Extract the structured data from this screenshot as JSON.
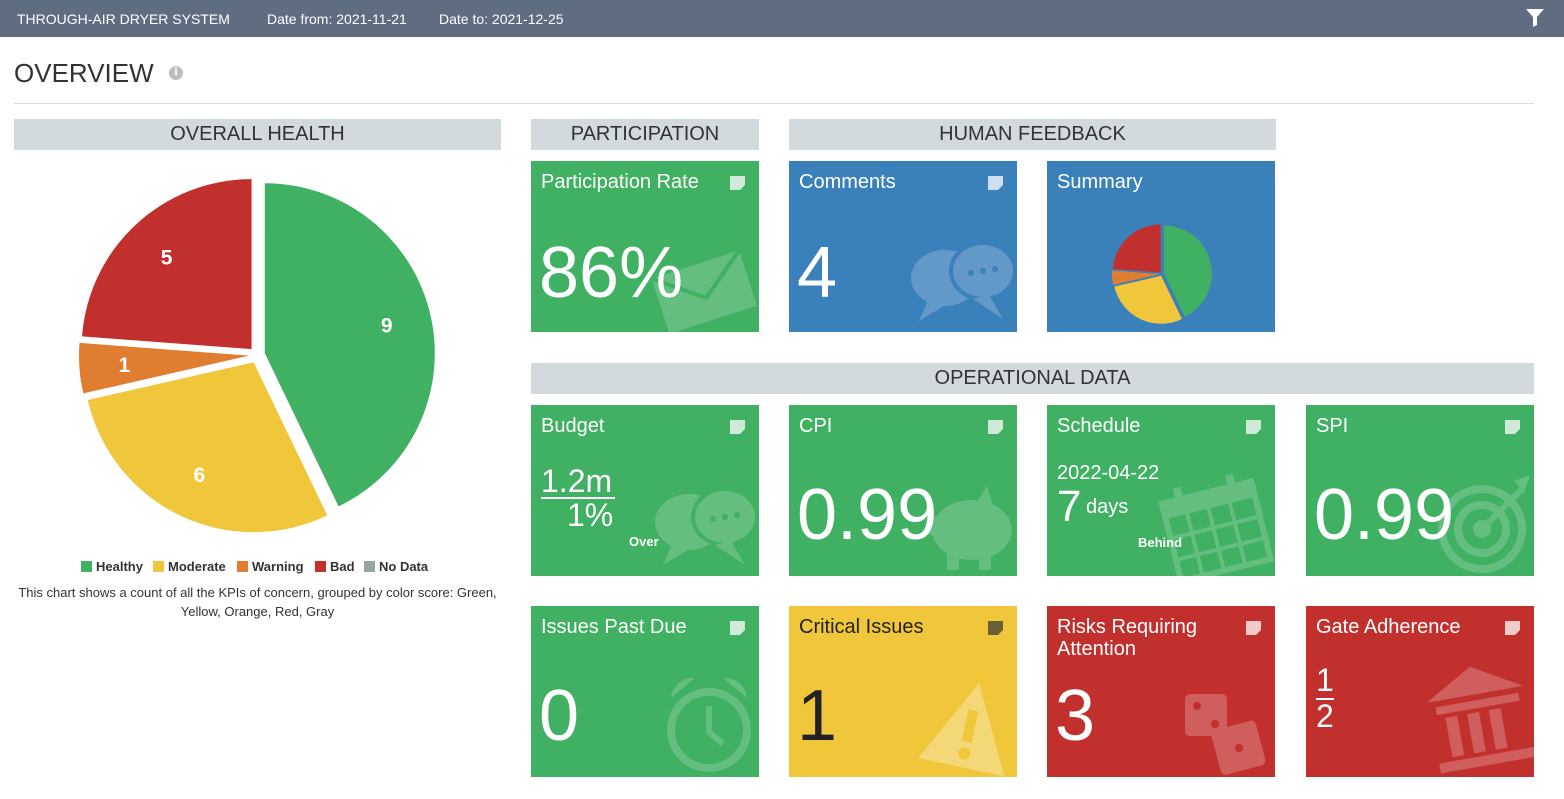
{
  "header": {
    "system": "THROUGH-AIR DRYER SYSTEM",
    "date_from": "Date from: 2021-11-21",
    "date_to": "Date to: 2021-12-25"
  },
  "page": {
    "title": "OVERVIEW"
  },
  "sections": {
    "overall_health": "OVERALL HEALTH",
    "participation": "PARTICIPATION",
    "human_feedback": "HUMAN FEEDBACK",
    "operational_data": "OPERATIONAL DATA"
  },
  "health": {
    "slices": [
      {
        "label": "Healthy",
        "value": 9,
        "color": "#40b063"
      },
      {
        "label": "Moderate",
        "value": 6,
        "color": "#f0c63a"
      },
      {
        "label": "Warning",
        "value": 1,
        "color": "#e07d30"
      },
      {
        "label": "Bad",
        "value": 5,
        "color": "#c2302e"
      },
      {
        "label": "No Data",
        "value": 0,
        "color": "#95a5a6"
      }
    ],
    "caption": "This chart shows a count of all the KPIs of concern, grouped by color score: Green, Yellow, Orange, Red, Gray"
  },
  "tiles": {
    "participation": {
      "label": "Participation Rate",
      "value": "86%"
    },
    "comments": {
      "label": "Comments",
      "value": "4"
    },
    "summary": {
      "label": "Summary"
    },
    "budget": {
      "label": "Budget",
      "amount": "1.2m",
      "percent": "1%",
      "status": "Over"
    },
    "cpi": {
      "label": "CPI",
      "value": "0.99"
    },
    "schedule": {
      "label": "Schedule",
      "date": "2022-04-22",
      "days": "7",
      "days_unit": "days",
      "status": "Behind"
    },
    "spi": {
      "label": "SPI",
      "value": "0.99"
    },
    "issues_past_due": {
      "label": "Issues Past Due",
      "value": "0"
    },
    "critical_issues": {
      "label": "Critical Issues",
      "value": "1"
    },
    "risks": {
      "label": "Risks Requiring Attention",
      "value": "3"
    },
    "gate": {
      "label": "Gate Adherence",
      "numerator": "1",
      "denominator": "2"
    }
  }
}
